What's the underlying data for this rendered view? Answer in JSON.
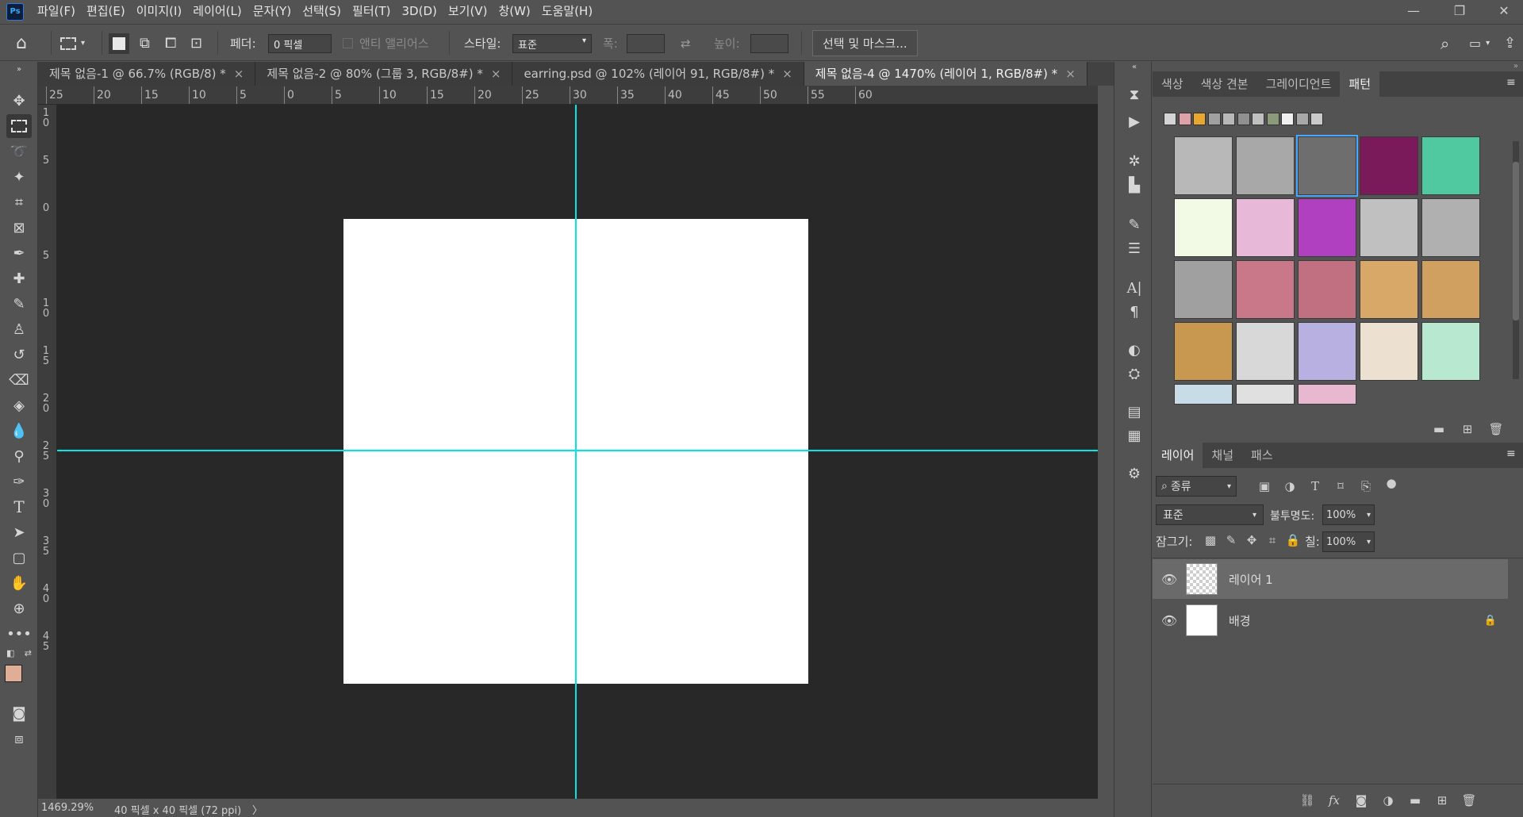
{
  "app": {
    "logo": "Ps"
  },
  "menu": [
    "파일(F)",
    "편집(E)",
    "이미지(I)",
    "레이어(L)",
    "문자(Y)",
    "선택(S)",
    "필터(T)",
    "3D(D)",
    "보기(V)",
    "창(W)",
    "도움말(H)"
  ],
  "window_controls": {
    "minimize": "—",
    "restore": "❐",
    "close": "✕"
  },
  "options": {
    "feather_label": "페더:",
    "feather_value": "0 픽셀",
    "antialias_label": "앤티 앨리어스",
    "style_label": "스타일:",
    "style_value": "표준",
    "width_label": "폭:",
    "height_label": "높이:",
    "select_mask_label": "선택 및 마스크..."
  },
  "tabs": [
    {
      "label": "제목 없음-1 @ 66.7% (RGB/8) *",
      "active": false
    },
    {
      "label": "제목 없음-2 @ 80% (그룹 3, RGB/8#) *",
      "active": false
    },
    {
      "label": "earring.psd @ 102% (레이어 91, RGB/8#) *",
      "active": false
    },
    {
      "label": "제목 없음-4 @ 1470% (레이어 1, RGB/8#) *",
      "active": true
    }
  ],
  "ruler_top": [
    "25",
    "20",
    "15",
    "10",
    "5",
    "0",
    "5",
    "10",
    "15",
    "20",
    "25",
    "30",
    "35",
    "40",
    "45",
    "50",
    "55",
    "60"
  ],
  "ruler_left": [
    "10",
    "5",
    "0",
    "5",
    "10",
    "15",
    "20",
    "25",
    "30",
    "35",
    "40",
    "45"
  ],
  "status": {
    "zoom": "1469.29%",
    "doc_info": "40 픽셀 x 40 픽셀 (72 ppi)",
    "arrow": "〉"
  },
  "colors": {
    "foreground": "#e0ad96",
    "background": "#ffffff",
    "guide": "#00e5e5",
    "canvas_bg": "#282828"
  },
  "swatch_panel": {
    "tabs": [
      {
        "label": "색상",
        "active": false
      },
      {
        "label": "색상 견본",
        "active": false
      },
      {
        "label": "그레이디언트",
        "active": false
      },
      {
        "label": "패턴",
        "active": true
      }
    ],
    "recent_colors": [
      "#d4d4d4",
      "#e0a0a8",
      "#e8a830",
      "#a0a0a0",
      "#b8b8b8",
      "#909090",
      "#c0c0c0",
      "#8a9a7a",
      "#f0f0f0",
      "#a8a8a8",
      "#cacaca"
    ]
  },
  "patterns": [
    {
      "name": "gray-noise-1",
      "bg": "#b8b8b8"
    },
    {
      "name": "gray-noise-2",
      "bg": "#a8a8a8"
    },
    {
      "name": "dark-noise",
      "bg": "#6e6e6e",
      "selected": true
    },
    {
      "name": "psychedelic-swirl",
      "bg": "#7a1a5a"
    },
    {
      "name": "green-rays",
      "bg": "#50c8a0"
    },
    {
      "name": "green-leaves",
      "bg": "#f2fae6"
    },
    {
      "name": "pink-splash",
      "bg": "#e8b8d8"
    },
    {
      "name": "color-shards",
      "bg": "#b040c0"
    },
    {
      "name": "silver-brushed",
      "bg": "#c0c0c0"
    },
    {
      "name": "silver-smooth",
      "bg": "#b0b0b0"
    },
    {
      "name": "concrete",
      "bg": "#a0a0a0"
    },
    {
      "name": "rose-metal-1",
      "bg": "#c87888"
    },
    {
      "name": "rose-metal-2",
      "bg": "#c07080"
    },
    {
      "name": "gold-foil-1",
      "bg": "#d8a868"
    },
    {
      "name": "gold-foil-2",
      "bg": "#d0a060"
    },
    {
      "name": "gold-glitter",
      "bg": "#c89850"
    },
    {
      "name": "black-marble",
      "bg": "#d8d8d8"
    },
    {
      "name": "violet-marble",
      "bg": "#b8b0e0"
    },
    {
      "name": "gold-marble",
      "bg": "#ece0d0"
    },
    {
      "name": "green-marble",
      "bg": "#b8e8d0"
    },
    {
      "name": "blue-marble",
      "bg": "#c8dce8"
    },
    {
      "name": "gray-marble",
      "bg": "#e0e0e0"
    },
    {
      "name": "pink-marble",
      "bg": "#e8b8d0"
    }
  ],
  "layers_panel": {
    "tabs": [
      {
        "label": "레이어",
        "active": true
      },
      {
        "label": "채널",
        "active": false
      },
      {
        "label": "패스",
        "active": false
      }
    ],
    "filter_label": "종류",
    "blend_mode": "표준",
    "opacity_label": "불투명도:",
    "opacity_value": "100%",
    "lock_label": "잠그기:",
    "fill_label": "칠:",
    "fill_value": "100%",
    "layers": [
      {
        "name": "레이어 1",
        "selected": true,
        "locked": false
      },
      {
        "name": "배경",
        "selected": false,
        "locked": true
      }
    ]
  }
}
